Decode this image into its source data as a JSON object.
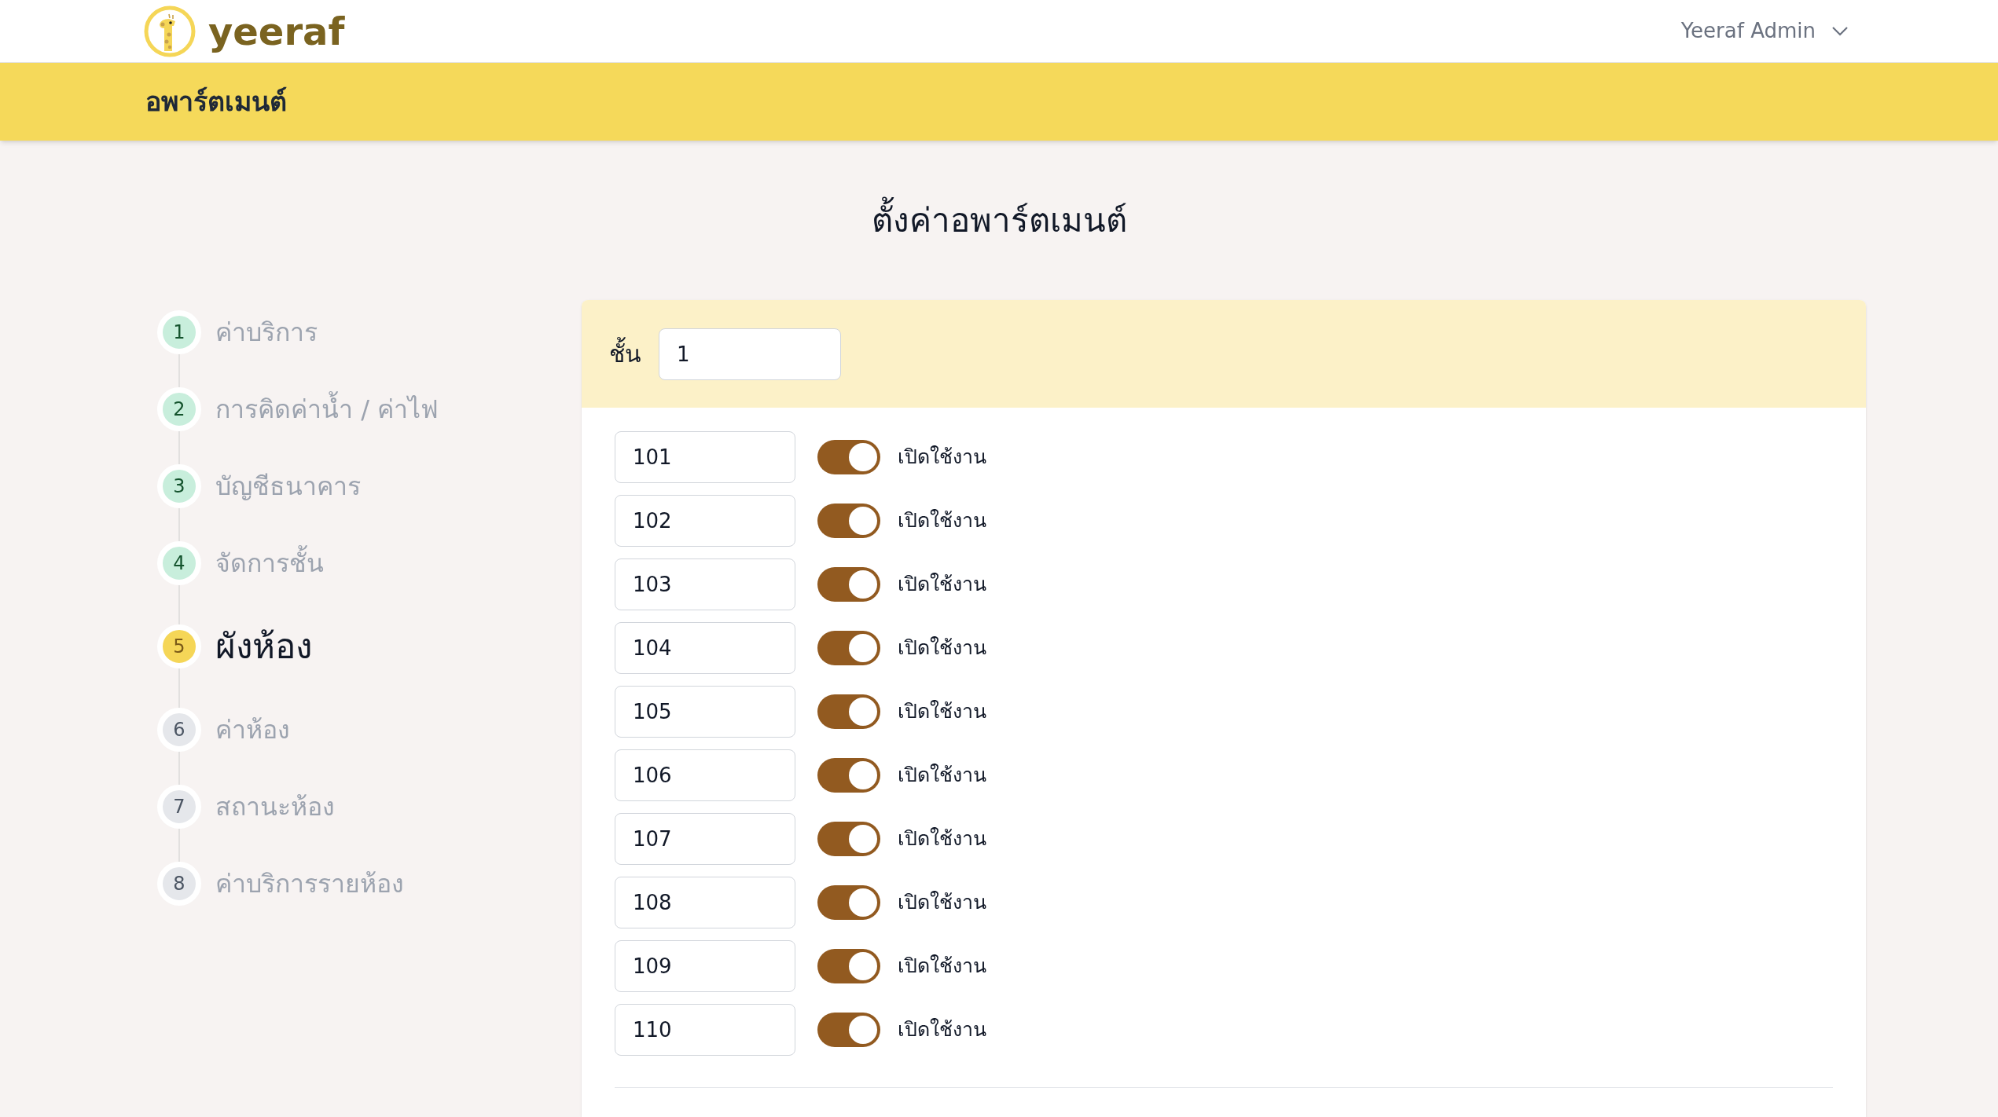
{
  "header": {
    "brand": "yeeraf",
    "user": "Yeeraf Admin"
  },
  "page_bar": {
    "title": "อพาร์ตเมนต์"
  },
  "heading": "ตั้งค่าอพาร์ตเมนต์",
  "steps": [
    {
      "number": "1",
      "label": "ค่าบริการ",
      "completed": true,
      "selected": false
    },
    {
      "number": "2",
      "label": "การคิดค่าน้ำ / ค่าไฟ",
      "completed": true,
      "selected": false
    },
    {
      "number": "3",
      "label": "บัญชีธนาคาร",
      "completed": true,
      "selected": false
    },
    {
      "number": "4",
      "label": "จัดการชั้น",
      "completed": true,
      "selected": false
    },
    {
      "number": "5",
      "label": "ผังห้อง",
      "completed": false,
      "selected": true
    },
    {
      "number": "6",
      "label": "ค่าห้อง",
      "completed": false,
      "selected": false
    },
    {
      "number": "7",
      "label": "สถานะห้อง",
      "completed": false,
      "selected": false
    },
    {
      "number": "8",
      "label": "ค่าบริการรายห้อง",
      "completed": false,
      "selected": false
    }
  ],
  "floor": {
    "label": "ชั้น",
    "value": "1"
  },
  "rooms": [
    {
      "value": "101",
      "on": true,
      "label": "เปิดใช้งาน"
    },
    {
      "value": "102",
      "on": true,
      "label": "เปิดใช้งาน"
    },
    {
      "value": "103",
      "on": true,
      "label": "เปิดใช้งาน"
    },
    {
      "value": "104",
      "on": true,
      "label": "เปิดใช้งาน"
    },
    {
      "value": "105",
      "on": true,
      "label": "เปิดใช้งาน"
    },
    {
      "value": "106",
      "on": true,
      "label": "เปิดใช้งาน"
    },
    {
      "value": "107",
      "on": true,
      "label": "เปิดใช้งาน"
    },
    {
      "value": "108",
      "on": true,
      "label": "เปิดใช้งาน"
    },
    {
      "value": "109",
      "on": true,
      "label": "เปิดใช้งาน"
    },
    {
      "value": "110",
      "on": true,
      "label": "เปิดใช้งาน"
    }
  ]
}
